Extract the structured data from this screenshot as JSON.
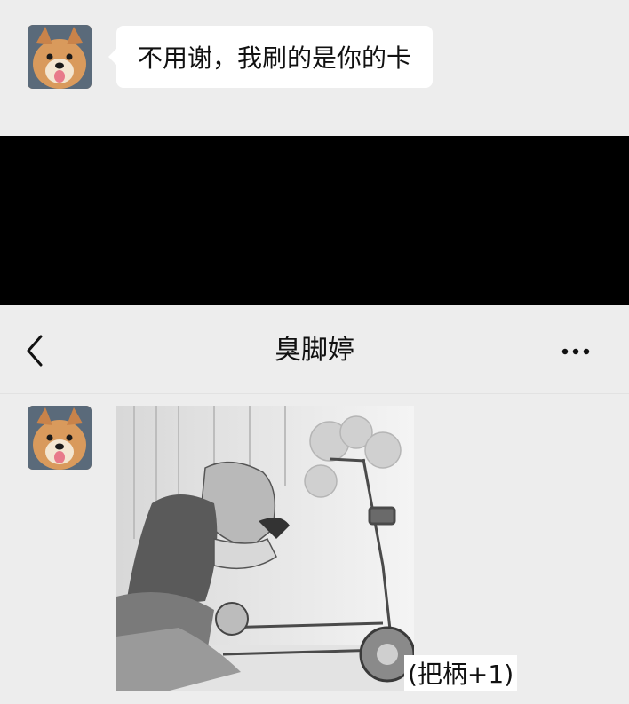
{
  "messages": [
    {
      "type": "text",
      "sender": "other",
      "avatar": "dog-avatar-icon",
      "text": "不用谢，我刷的是你的卡"
    }
  ],
  "navbar": {
    "title": "臭脚婷",
    "back_icon": "chevron-left-icon",
    "more_icon": "ellipsis-icon"
  },
  "image_message": {
    "sender": "other",
    "avatar": "dog-avatar-icon",
    "content": "manga-illustration-image",
    "caption": "(把柄+1)"
  },
  "colors": {
    "background": "#ededed",
    "bubble": "#ffffff",
    "band": "#000000"
  }
}
